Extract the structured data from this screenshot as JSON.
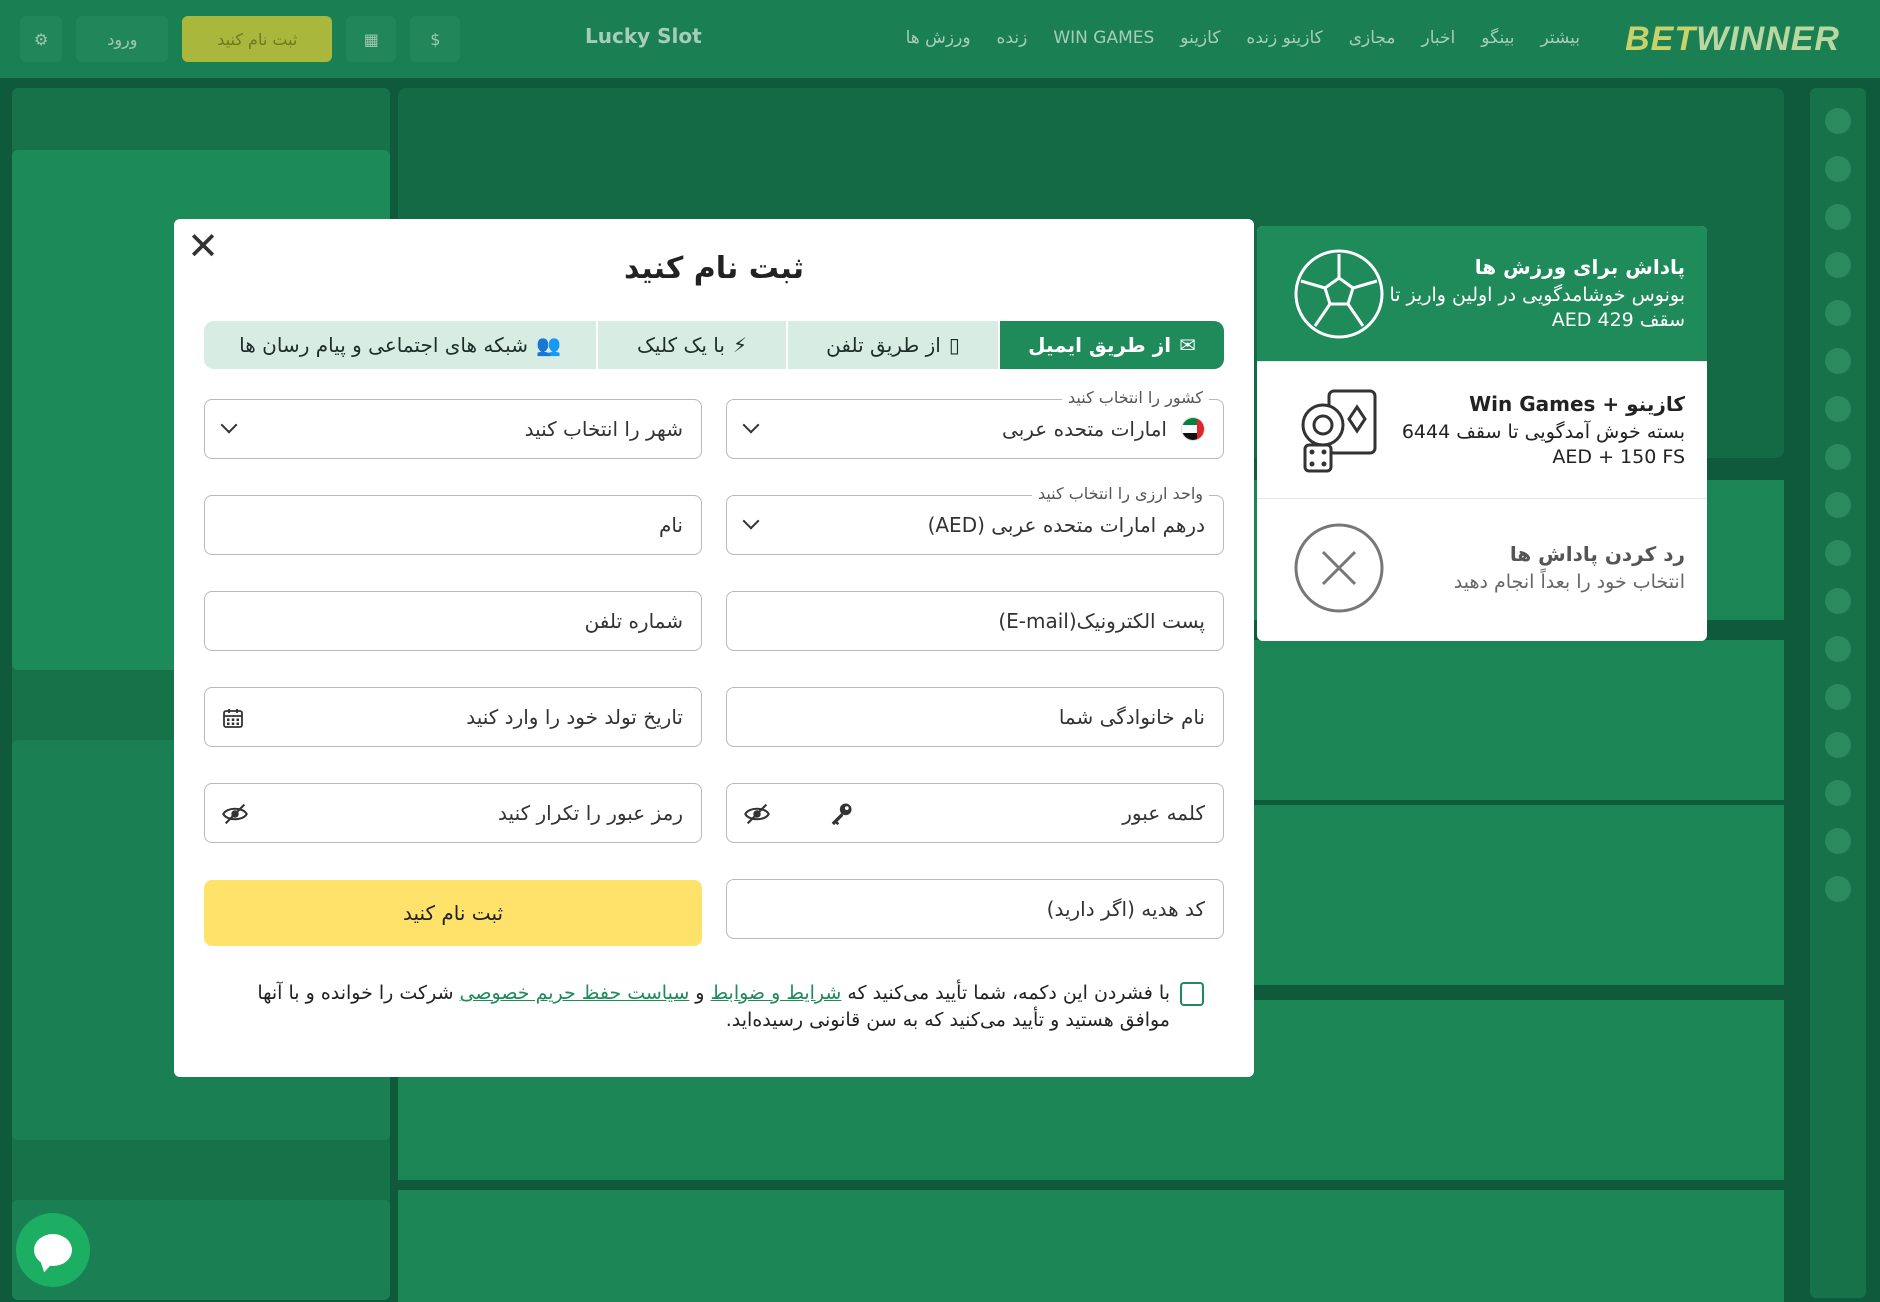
{
  "site": {
    "brand_a": "BET",
    "brand_b": "WINNER",
    "nav": [
      "ورزش ها",
      "زنده",
      "WIN GAMES",
      "کازینو",
      "کازینو زنده",
      "مجازی",
      "اخبار",
      "بینگو",
      "بیشتر"
    ],
    "lucky_slot": "Lucky Slot",
    "register_top": "ثبت نام کنید",
    "login_top": "ورود"
  },
  "modal": {
    "title": "ثبت نام کنید",
    "close": "✕",
    "tabs": [
      {
        "label": "از طریق ایمیل",
        "icon": "✉"
      },
      {
        "label": "از طریق تلفن",
        "icon": "▯"
      },
      {
        "label": "با یک کلیک",
        "icon": "⚡"
      },
      {
        "label": "شبکه های اجتماعی و پیام رسان ها",
        "icon": "👥"
      }
    ],
    "country_label": "کشور را انتخاب کنید",
    "country_value": "امارات متحده عربی",
    "city_placeholder": "شهر را انتخاب کنید",
    "currency_label": "واحد ارزی را انتخاب کنید",
    "currency_value": "درهم امارات متحده عربی (AED)",
    "name_placeholder": "نام",
    "email_placeholder": "پست الکترونیک(E-mail)",
    "phone_placeholder": "شماره تلفن",
    "surname_placeholder": "نام خانوادگی شما",
    "birthdate_placeholder": "تاریخ تولد خود را وارد کنید",
    "password_placeholder": "کلمه عبور",
    "password_repeat_placeholder": "رمز عبور را تکرار کنید",
    "promo_placeholder": "کد هدیه (اگر دارید)",
    "submit": "ثبت نام کنید",
    "consent_a": "با فشردن این دکمه، شما تأیید می‌کنید که ",
    "consent_link1": "شرایط و ضوابط",
    "consent_b": " و ",
    "consent_link2": "سیاست حفظ حریم خصوصی",
    "consent_c": " شرکت را خوانده و با آنها موافق هستید و تأیید می‌کنید که به سن قانونی رسیده‌اید."
  },
  "bonus": {
    "items": [
      {
        "title": "پاداش برای ورزش ها",
        "desc": "بونوس خوشامدگویی در اولین واریز تا سقف 429 AED"
      },
      {
        "title": "کازینو + Win Games",
        "desc": "بسته خوش آمدگویی تا سقف 6444 AED + 150 FS"
      },
      {
        "title": "رد کردن پاداش ها",
        "desc": "انتخاب خود را بعداً انجام دهید"
      }
    ]
  },
  "colors": {
    "accent": "#1f8a5a",
    "submit": "#ffe26a",
    "overlay": "#0f5a3b"
  }
}
